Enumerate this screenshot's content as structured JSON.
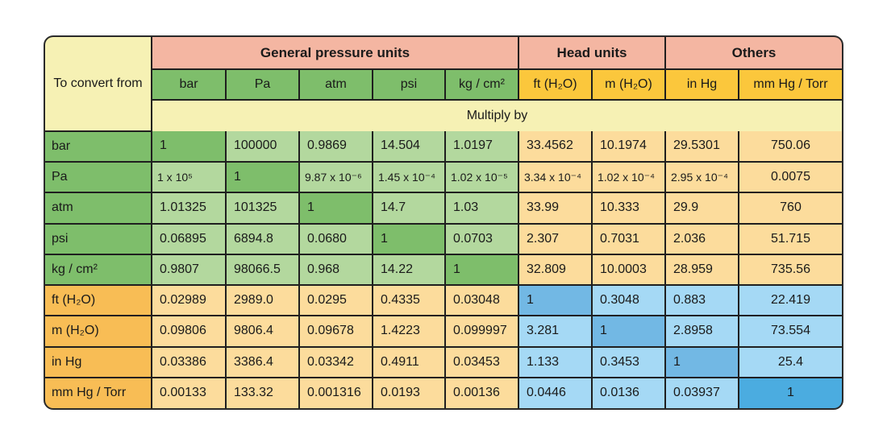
{
  "corner_label": "To convert from",
  "groups": [
    {
      "label": "General pressure units"
    },
    {
      "label": "Head units"
    },
    {
      "label": "Others"
    }
  ],
  "units": [
    "bar",
    "Pa",
    "atm",
    "psi",
    "kg / cm²",
    "ft (H₂O)",
    "m (H₂O)",
    "in Hg",
    "mm Hg / Torr"
  ],
  "multiply_label": "Multiply by",
  "rows": [
    {
      "label": "bar",
      "values": [
        "1",
        "100000",
        "0.9869",
        "14.504",
        "1.0197",
        "33.4562",
        "10.1974",
        "29.5301",
        "750.06"
      ]
    },
    {
      "label": "Pa",
      "values": [
        "1 x 10⁵",
        "1",
        "9.87 x 10⁻⁶",
        "1.45 x 10⁻⁴",
        "1.02 x 10⁻⁵",
        "3.34 x 10⁻⁴",
        "1.02 x 10⁻⁴",
        "2.95 x 10⁻⁴",
        "0.0075"
      ]
    },
    {
      "label": "atm",
      "values": [
        "1.01325",
        "101325",
        "1",
        "14.7",
        "1.03",
        "33.99",
        "10.333",
        "29.9",
        "760"
      ]
    },
    {
      "label": "psi",
      "values": [
        "0.06895",
        "6894.8",
        "0.0680",
        "1",
        "0.0703",
        "2.307",
        "0.7031",
        "2.036",
        "51.715"
      ]
    },
    {
      "label": "kg / cm²",
      "values": [
        "0.9807",
        "98066.5",
        "0.968",
        "14.22",
        "1",
        "32.809",
        "10.0003",
        "28.959",
        "735.56"
      ]
    },
    {
      "label": "ft (H₂O)",
      "values": [
        "0.02989",
        "2989.0",
        "0.0295",
        "0.4335",
        "0.03048",
        "1",
        "0.3048",
        "0.883",
        "22.419"
      ]
    },
    {
      "label": "m (H₂O)",
      "values": [
        "0.09806",
        "9806.4",
        "0.09678",
        "1.4223",
        "0.099997",
        "3.281",
        "1",
        "2.8958",
        "73.554"
      ]
    },
    {
      "label": "in Hg",
      "values": [
        "0.03386",
        "3386.4",
        "0.03342",
        "0.4911",
        "0.03453",
        "1.133",
        "0.3453",
        "1",
        "25.4"
      ]
    },
    {
      "label": "mm Hg / Torr",
      "values": [
        "0.00133",
        "133.32",
        "0.001316",
        "0.0193",
        "0.00136",
        "0.0446",
        "0.0136",
        "0.03937",
        "1"
      ]
    }
  ],
  "colors": {
    "group_header": "#f4b6a2",
    "general_units": "#7ebe6b",
    "other_units": "#fbc73c",
    "neutral": "#f6f1b4",
    "light_green": "#b3d89e",
    "peach": "#fcdc9c",
    "light_blue": "#a5d9f5",
    "dark_blue": "#72b8e4"
  }
}
